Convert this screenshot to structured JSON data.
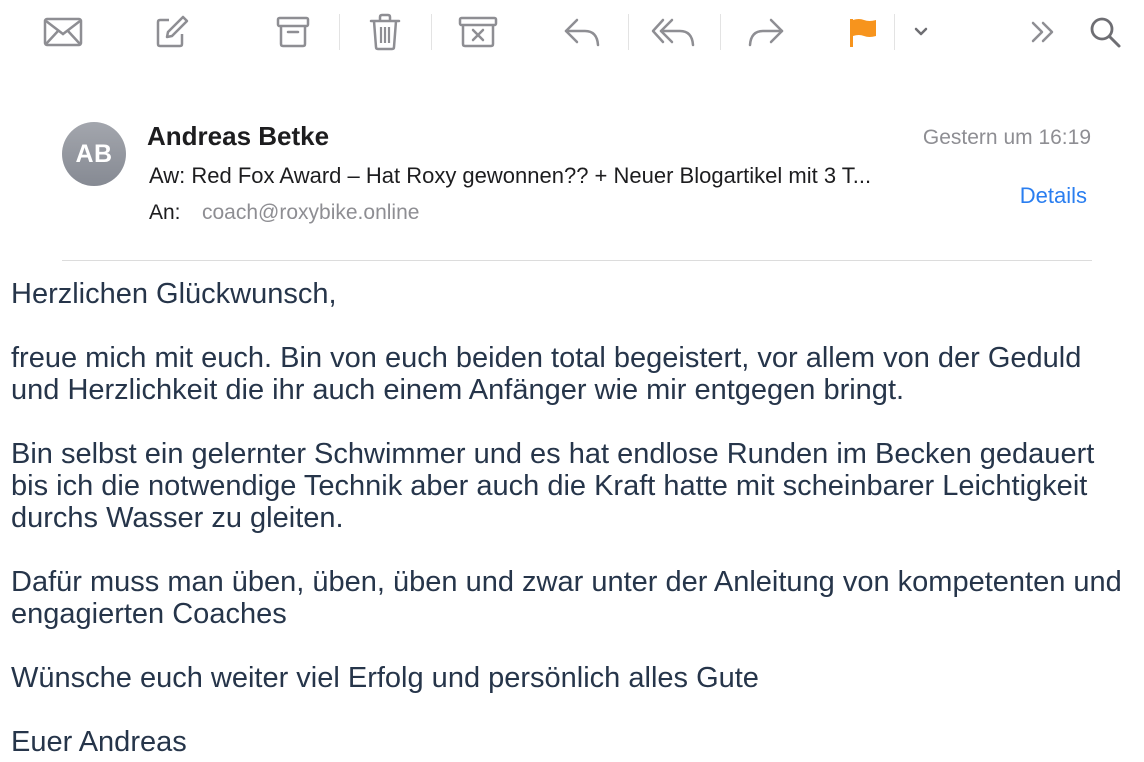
{
  "toolbar": {
    "buttons": [
      {
        "icon": "envelope-icon",
        "name": "get-mail"
      },
      {
        "icon": "compose-icon",
        "name": "compose"
      },
      {
        "icon": "archive-icon",
        "name": "archive"
      },
      {
        "icon": "trash-icon",
        "name": "delete"
      },
      {
        "icon": "junk-icon",
        "name": "junk"
      },
      {
        "icon": "reply-icon",
        "name": "reply"
      },
      {
        "icon": "reply-all-icon",
        "name": "reply-all"
      },
      {
        "icon": "forward-icon",
        "name": "forward"
      },
      {
        "icon": "flag-icon",
        "name": "flag"
      },
      {
        "icon": "chevron-down-icon",
        "name": "flag-menu"
      },
      {
        "icon": "double-chevron-right-icon",
        "name": "more"
      },
      {
        "icon": "search-icon",
        "name": "search"
      }
    ],
    "flag_color": "#f7941d",
    "icon_color": "#8e8e93"
  },
  "message": {
    "avatar_initials": "AB",
    "sender": "Andreas Betke",
    "timestamp": "Gestern um 16:19",
    "subject": "Aw: Red Fox Award – Hat Roxy gewonnen?? + Neuer Blogartikel mit 3 T...",
    "details_label": "Details",
    "to_label": "An:",
    "to_address": "coach@roxybike.online",
    "link_color": "#2a7ef0"
  },
  "body": {
    "paragraphs": [
      "Herzlichen Glückwunsch,",
      "freue mich mit euch. Bin von euch beiden total begeistert, vor allem von der Geduld und Herzlichkeit die ihr auch einem Anfänger wie mir entgegen bringt.",
      "Bin selbst ein gelernter Schwimmer und es hat endlose Runden im Becken gedauert bis ich die notwendige Technik aber auch die Kraft hatte mit scheinbarer Leichtigkeit durchs Wasser zu gleiten.",
      "Dafür muss man üben, üben, üben und zwar unter der Anleitung von kompetenten und engagierten Coaches",
      "Wünsche euch weiter viel Erfolg und persönlich alles Gute",
      "Euer Andreas"
    ]
  }
}
